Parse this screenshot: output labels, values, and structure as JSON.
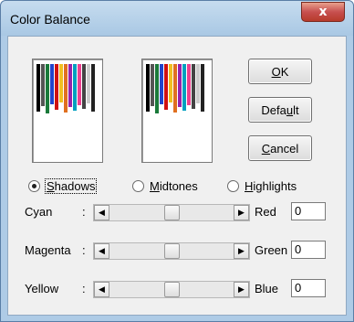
{
  "window": {
    "title": "Color Balance",
    "close_label": "x"
  },
  "preview": {
    "stripe_colors": [
      "#000000",
      "#555555",
      "#1a7a3a",
      "#2244cc",
      "#d01010",
      "#f0c020",
      "#e07020",
      "#9922aa",
      "#00a0c0",
      "#ee4090",
      "#444444",
      "#cccccc",
      "#222222"
    ]
  },
  "buttons": {
    "ok": {
      "prefix": "",
      "mnemonic": "O",
      "suffix": "K"
    },
    "default": {
      "prefix": "Defa",
      "mnemonic": "u",
      "suffix": "lt"
    },
    "cancel": {
      "prefix": "",
      "mnemonic": "C",
      "suffix": "ancel"
    }
  },
  "tone": {
    "options": [
      {
        "prefix": "",
        "mnemonic": "S",
        "suffix": "hadows",
        "checked": true
      },
      {
        "prefix": "",
        "mnemonic": "M",
        "suffix": "idtones",
        "checked": false
      },
      {
        "prefix": "",
        "mnemonic": "H",
        "suffix": "ighlights",
        "checked": false
      }
    ]
  },
  "sliders": [
    {
      "left_label": "Cyan",
      "separator": ":",
      "right_label": "Red",
      "value": "0",
      "level": 0.5
    },
    {
      "left_label": "Magenta",
      "separator": ":",
      "right_label": "Green",
      "value": "0",
      "level": 0.5
    },
    {
      "left_label": "Yellow",
      "separator": ":",
      "right_label": "Blue",
      "value": "0",
      "level": 0.5
    }
  ]
}
